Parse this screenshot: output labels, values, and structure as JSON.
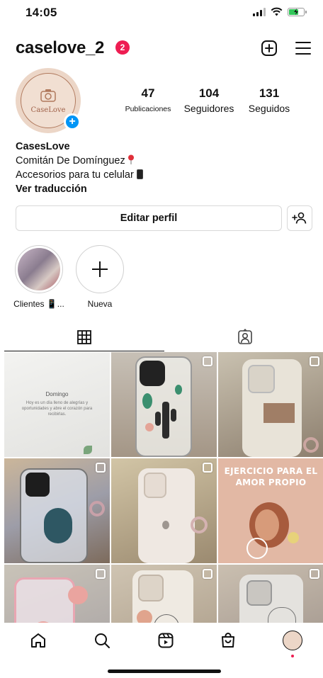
{
  "status_bar": {
    "time": "14:05"
  },
  "header": {
    "username": "caselove_2",
    "notification_count": "2"
  },
  "profile": {
    "avatar_logo_text": "CaseLove",
    "stats": [
      {
        "value": "47",
        "label": "Publicaciones"
      },
      {
        "value": "104",
        "label": "Seguidores"
      },
      {
        "value": "131",
        "label": "Seguidos"
      }
    ],
    "bio": {
      "name": "CasesLove",
      "location": "Comitán De Domínguez",
      "description": "Accesorios para tu celular",
      "translate_link": "Ver traducción"
    },
    "edit_button": "Editar perfil"
  },
  "highlights": [
    {
      "label": "Clientes 📱..."
    },
    {
      "label": "Nueva"
    }
  ],
  "posts": [
    {
      "title": "Domingo",
      "text": "Hoy es un día lleno de alegrías y oportunidades y abre el corazón para recibirlas."
    },
    {
      "title": ""
    },
    {
      "title": ""
    },
    {
      "title": ""
    },
    {
      "title": ""
    },
    {
      "title": "EJERCICIO PARA EL AMOR PROPIO"
    },
    {
      "title": ""
    },
    {
      "title": ""
    },
    {
      "title": ""
    }
  ],
  "colors": {
    "accent_blue": "#0095f6",
    "badge_red": "#ee1d52",
    "avatar_bg": "#ecd6c7"
  }
}
